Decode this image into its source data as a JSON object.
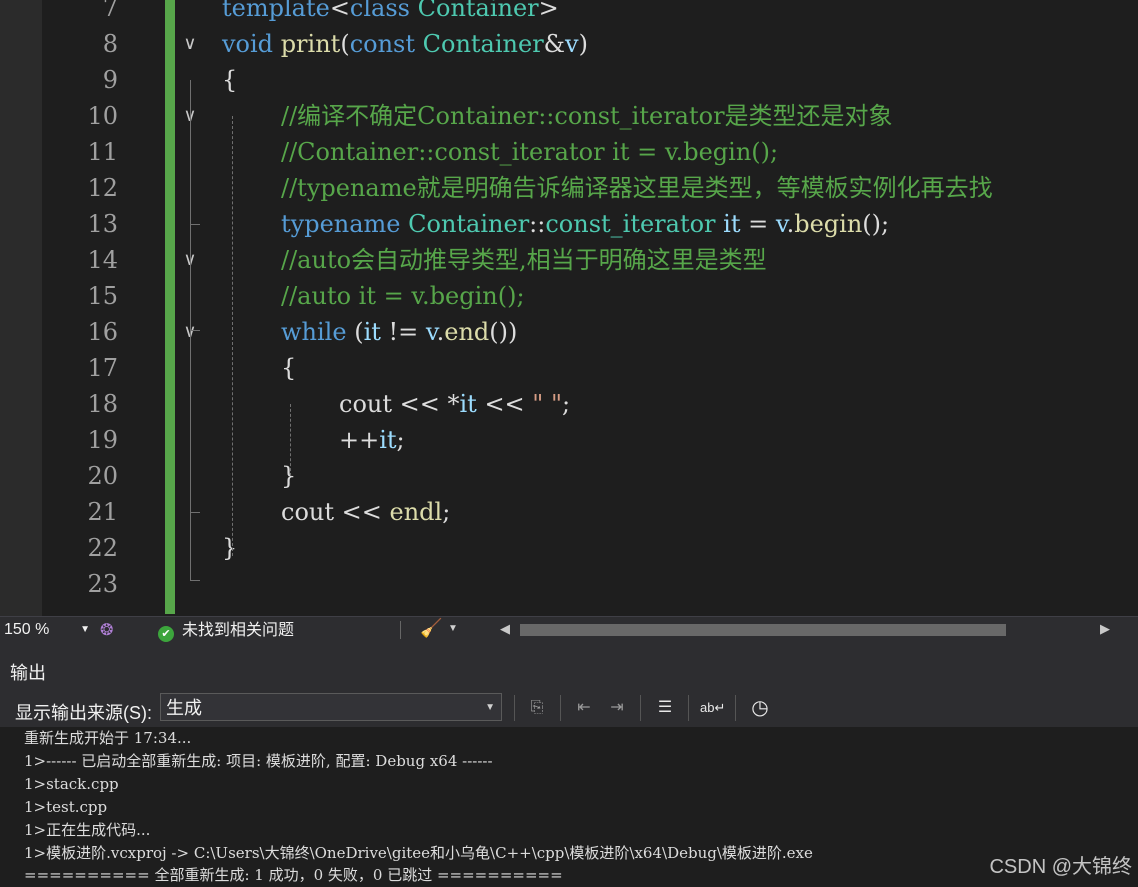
{
  "colors": {
    "keyword": "#569cd6",
    "type": "#4ec9b0",
    "function": "#dcdcaa",
    "comment": "#57a64a",
    "text": "#dcdcdc",
    "variable": "#9cdcfe",
    "string": "#d69d85",
    "changebar": "#57a64a"
  },
  "editor": {
    "lines": [
      {
        "num": "7",
        "tokens": [
          {
            "t": "template",
            "c": "keyword"
          },
          {
            "t": "<",
            "c": "text"
          },
          {
            "t": "class",
            "c": "keyword"
          },
          {
            "t": " ",
            "c": "text"
          },
          {
            "t": "Container",
            "c": "type"
          },
          {
            "t": ">",
            "c": "text"
          }
        ]
      },
      {
        "num": "8",
        "tokens": [
          {
            "t": "void",
            "c": "keyword"
          },
          {
            "t": " ",
            "c": "text"
          },
          {
            "t": "print",
            "c": "function"
          },
          {
            "t": "(",
            "c": "text"
          },
          {
            "t": "const",
            "c": "keyword"
          },
          {
            "t": " ",
            "c": "text"
          },
          {
            "t": "Container",
            "c": "type"
          },
          {
            "t": "&",
            "c": "text"
          },
          {
            "t": "v",
            "c": "variable"
          },
          {
            "t": ")",
            "c": "text"
          }
        ]
      },
      {
        "num": "9",
        "tokens": [
          {
            "t": "{",
            "c": "text"
          }
        ]
      },
      {
        "num": "10",
        "tokens": [
          {
            "t": "//编译不确定Container::const_iterator是类型还是对象",
            "c": "comment"
          }
        ]
      },
      {
        "num": "11",
        "tokens": [
          {
            "t": "//Container::const_iterator it = v.begin();",
            "c": "comment"
          }
        ]
      },
      {
        "num": "12",
        "tokens": [
          {
            "t": "//typename就是明确告诉编译器这里是类型，等模板实例化再去找",
            "c": "comment"
          }
        ]
      },
      {
        "num": "13",
        "tokens": [
          {
            "t": "typename",
            "c": "keyword"
          },
          {
            "t": " ",
            "c": "text"
          },
          {
            "t": "Container",
            "c": "type"
          },
          {
            "t": "::",
            "c": "text"
          },
          {
            "t": "const_iterator",
            "c": "type"
          },
          {
            "t": " ",
            "c": "text"
          },
          {
            "t": "it",
            "c": "variable"
          },
          {
            "t": " = ",
            "c": "text"
          },
          {
            "t": "v",
            "c": "variable"
          },
          {
            "t": ".",
            "c": "text"
          },
          {
            "t": "begin",
            "c": "function"
          },
          {
            "t": "();",
            "c": "text"
          }
        ]
      },
      {
        "num": "14",
        "tokens": [
          {
            "t": "//auto会自动推导类型,相当于明确这里是类型",
            "c": "comment"
          }
        ]
      },
      {
        "num": "15",
        "tokens": [
          {
            "t": "//auto it = v.begin();",
            "c": "comment"
          }
        ]
      },
      {
        "num": "16",
        "tokens": [
          {
            "t": "while",
            "c": "keyword"
          },
          {
            "t": " (",
            "c": "text"
          },
          {
            "t": "it",
            "c": "variable"
          },
          {
            "t": " != ",
            "c": "text"
          },
          {
            "t": "v",
            "c": "variable"
          },
          {
            "t": ".",
            "c": "text"
          },
          {
            "t": "end",
            "c": "function"
          },
          {
            "t": "())",
            "c": "text"
          }
        ]
      },
      {
        "num": "17",
        "tokens": [
          {
            "t": "{",
            "c": "text"
          }
        ]
      },
      {
        "num": "18",
        "tokens": [
          {
            "t": "cout",
            "c": "text"
          },
          {
            "t": " << *",
            "c": "text"
          },
          {
            "t": "it",
            "c": "variable"
          },
          {
            "t": " << ",
            "c": "text"
          },
          {
            "t": "\" \"",
            "c": "string"
          },
          {
            "t": ";",
            "c": "text"
          }
        ]
      },
      {
        "num": "19",
        "tokens": [
          {
            "t": "++",
            "c": "text"
          },
          {
            "t": "it",
            "c": "variable"
          },
          {
            "t": ";",
            "c": "text"
          }
        ]
      },
      {
        "num": "20",
        "tokens": [
          {
            "t": "}",
            "c": "text"
          }
        ]
      },
      {
        "num": "21",
        "tokens": [
          {
            "t": "cout",
            "c": "text"
          },
          {
            "t": " << ",
            "c": "text"
          },
          {
            "t": "endl",
            "c": "function"
          },
          {
            "t": ";",
            "c": "text"
          }
        ]
      },
      {
        "num": "22",
        "tokens": [
          {
            "t": "}",
            "c": "text"
          }
        ]
      },
      {
        "num": "23",
        "tokens": []
      }
    ]
  },
  "statusbar": {
    "zoom": "150 %",
    "issues": "未找到相关问题"
  },
  "output": {
    "title": "输出",
    "source_label": "显示输出来源(S):",
    "source_value": "生成",
    "lines": [
      "重新生成开始于 17:34...",
      "1>------ 已启动全部重新生成: 项目: 模板进阶, 配置: Debug x64 ------",
      "1>stack.cpp",
      "1>test.cpp",
      "1>正在生成代码...",
      "1>模板进阶.vcxproj -> C:\\Users\\大锦终\\OneDrive\\gitee和小乌龟\\C++\\cpp\\模板进阶\\x64\\Debug\\模板进阶.exe",
      "========== 全部重新生成: 1 成功，0 失败，0 已跳过 =========="
    ]
  },
  "watermark": "CSDN @大锦终"
}
